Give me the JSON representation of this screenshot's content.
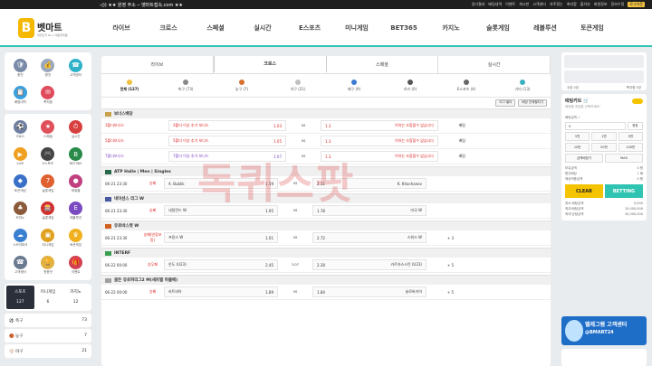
{
  "topbar": {
    "notice": "◁)) ★★ 원영 주소 ─ 벳마트접속.com ★★",
    "links": [
      "경기결과",
      "배팅내역",
      "이벤트",
      "게시판",
      "고객센터",
      "자주찾는",
      "축지함",
      "출석부",
      "회원정보",
      "정보수정",
      "로그아웃"
    ]
  },
  "logo": {
    "mark": "B",
    "name": "벳마트",
    "tag": "대한민국 No.1 배팅플랫폼"
  },
  "menu": [
    "라이브",
    "크로스",
    "스페셜",
    "실시간",
    "E스포츠",
    "미니게임",
    "BET365",
    "카지노",
    "슬롯게임",
    "레볼루션",
    "토큰게임"
  ],
  "sidebar": {
    "panel1": [
      {
        "label": "충전",
        "color": "#7a8ba8",
        "icon": "🛡"
      },
      {
        "label": "환전",
        "color": "#9aa7bd",
        "icon": "💰"
      },
      {
        "label": "고객센터",
        "color": "#2fb2c9",
        "icon": "☎"
      },
      {
        "label": "배팅내역",
        "color": "#3aa0e0",
        "icon": "📋"
      },
      {
        "label": "쪽지함",
        "color": "#e04a5a",
        "icon": "✉"
      }
    ],
    "panel2": [
      {
        "label": "크로스",
        "color": "#6e7fa0",
        "icon": "⚽"
      },
      {
        "label": "스페셜",
        "color": "#e0505a",
        "icon": "★"
      },
      {
        "label": "실시간",
        "color": "#d84040",
        "icon": "⏱"
      },
      {
        "label": "LIVE",
        "color": "#f0a020",
        "icon": "▶"
      },
      {
        "label": "E스포츠",
        "color": "#444",
        "icon": "🎮"
      },
      {
        "label": "BET365",
        "color": "#2a8a4a",
        "icon": "B"
      },
      {
        "label": "토큰게임",
        "color": "#3a70c8",
        "icon": "◆"
      },
      {
        "label": "슬롯게임",
        "color": "#e06030",
        "icon": "7"
      },
      {
        "label": "파워볼",
        "color": "#c04080",
        "icon": "●"
      },
      {
        "label": "카지노",
        "color": "#8a5a3a",
        "icon": "♣"
      },
      {
        "label": "슬롯게임",
        "color": "#d03030",
        "icon": "🎰"
      },
      {
        "label": "에볼루션",
        "color": "#7a4ac0",
        "icon": "E"
      },
      {
        "label": "스카이파크",
        "color": "#3a80d0",
        "icon": "☁"
      },
      {
        "label": "미니게임",
        "color": "#e0a020",
        "icon": "▣"
      },
      {
        "label": "토큰게임",
        "color": "#f0b020",
        "icon": "♛"
      },
      {
        "label": "고객센터",
        "color": "#6a7a90",
        "icon": "☎"
      },
      {
        "label": "첫충전",
        "color": "#e0b040",
        "icon": "🏆"
      },
      {
        "label": "이벤트",
        "color": "#d04050",
        "icon": "🎁"
      }
    ],
    "counts": [
      {
        "label": "스포츠",
        "value": "127",
        "active": true
      },
      {
        "label": "미니게임",
        "value": "6",
        "active": false
      },
      {
        "label": "카지노",
        "value": "12",
        "active": false
      }
    ],
    "sports": [
      {
        "icon": "⚽",
        "label": "축구",
        "value": "73"
      },
      {
        "icon": "🏀",
        "label": "농구",
        "value": "7"
      },
      {
        "icon": "⚾",
        "label": "야구",
        "value": "21"
      }
    ]
  },
  "main": {
    "tabs": [
      "라이브",
      "크로스",
      "스페셜",
      "실시간"
    ],
    "active_tab": 1,
    "sports": [
      {
        "label": "전체 (127)",
        "color": "#f0c040",
        "active": true
      },
      {
        "label": "축구 (73)",
        "color": "#888"
      },
      {
        "label": "농구 (7)",
        "color": "#d87030"
      },
      {
        "label": "야구 (21)",
        "color": "#c0c0c0"
      },
      {
        "label": "배구 (9)",
        "color": "#3a7ad0"
      },
      {
        "label": "하키 (0)",
        "color": "#555"
      },
      {
        "label": "E스포츠 (4)",
        "color": "#666"
      },
      {
        "label": "기타 (13)",
        "color": "#3ab0c0"
      }
    ],
    "toolbar": [
      "리그 필터",
      "배당 전체펼치기"
    ],
    "bonus_league": "보너스배당",
    "bonus_rows": [
      {
        "label": "3폴더보너스",
        "home": "3폴더 이상 추가 보너스",
        "odds": "1.03",
        "vs": "VS",
        "draw": "1.3",
        "away": "이하는 조합할수 없습니다",
        "badge": "배팅",
        "color": "#d22"
      },
      {
        "label": "5폴더보너스",
        "home": "5폴더 이상 추가 보너스",
        "odds": "1.05",
        "vs": "VS",
        "draw": "1.3",
        "away": "이하는 조합할수 없습니다",
        "badge": "배팅",
        "color": "#d22"
      },
      {
        "label": "7폴더보너스",
        "home": "7폴더 이상 추가 보너스",
        "odds": "1.07",
        "vs": "VS",
        "draw": "1.3",
        "away": "이하는 조합할수 없습니다",
        "badge": "배팅",
        "color": "#7a40c0"
      }
    ],
    "games": [
      {
        "league": "ATP Halle | Men | Singles",
        "flag": "#2a6a4a",
        "time": "06-21 23:30",
        "status": "승패",
        "home": "A. Bublik",
        "hodds": "1.59",
        "vs": "VS",
        "away": "2.11",
        "aname": "K. Khachanov",
        "more": ""
      },
      {
        "league": "네이션스 리그 W",
        "flag": "#4a5aa0",
        "time": "06-21 23:30",
        "status": "승패",
        "home": "네덜란드 W",
        "hodds": "1.95",
        "vs": "VS",
        "away": "1.78",
        "aname": "미국 W",
        "more": ""
      },
      {
        "league": "유로바스켓 W",
        "flag": "#d06020",
        "time": "06-21 23:30",
        "status": "승패(연장포함)",
        "home": "프랑스 W",
        "hodds": "1.01",
        "vs": "VS",
        "away": "2.72",
        "aname": "스위스 W",
        "more": "+ 3"
      },
      {
        "league": "INTERF",
        "flag": "#3aa050",
        "time": "06-22 00:00",
        "status": "승무패",
        "home": "안도 (U23)",
        "hodds": "2.45",
        "vs": "3.07",
        "away": "2.28",
        "aname": "카르카스스턴 (U23)",
        "more": "+ 5"
      },
      {
        "league": "골든 유로파리그2 M(세트별 마블배)",
        "flag": "#a0a0a0",
        "time": "06-22 00:00",
        "status": "승패",
        "home": "라트비아",
        "hodds": "1.89",
        "vs": "VS",
        "away": "1.84",
        "aname": "슬로바키아",
        "more": "+ 5"
      }
    ]
  },
  "right": {
    "login_points": [
      "쿠폰 0장",
      "쪽지함 0장"
    ],
    "slip": {
      "title": "배팅카트 🛒",
      "sub": "배팅할 게임을 선택하세요!",
      "amount_label": "배팅금액 ✓",
      "amount": "0",
      "reset": "정정",
      "quick": [
        "5천",
        "1만",
        "5만",
        "10만",
        "50만",
        "100만"
      ],
      "half": [
        "금액배정기",
        "MAX"
      ],
      "info": [
        [
          "보유금액",
          "0 원"
        ],
        [
          "합산배당",
          "1 배"
        ],
        [
          "예상적중금액",
          "0 원"
        ]
      ],
      "clear": "CLEAR",
      "betting": "BETTING",
      "limits": [
        [
          "최소 배팅금액",
          "5,000"
        ],
        [
          "최대 배팅금액",
          "10,000,000"
        ],
        [
          "최대 당첨금액",
          "30,000,000"
        ]
      ]
    },
    "banner": {
      "line1": "텔레그램 고객센터",
      "line2": "@BMART24"
    }
  },
  "watermark": "독퀴스팟"
}
